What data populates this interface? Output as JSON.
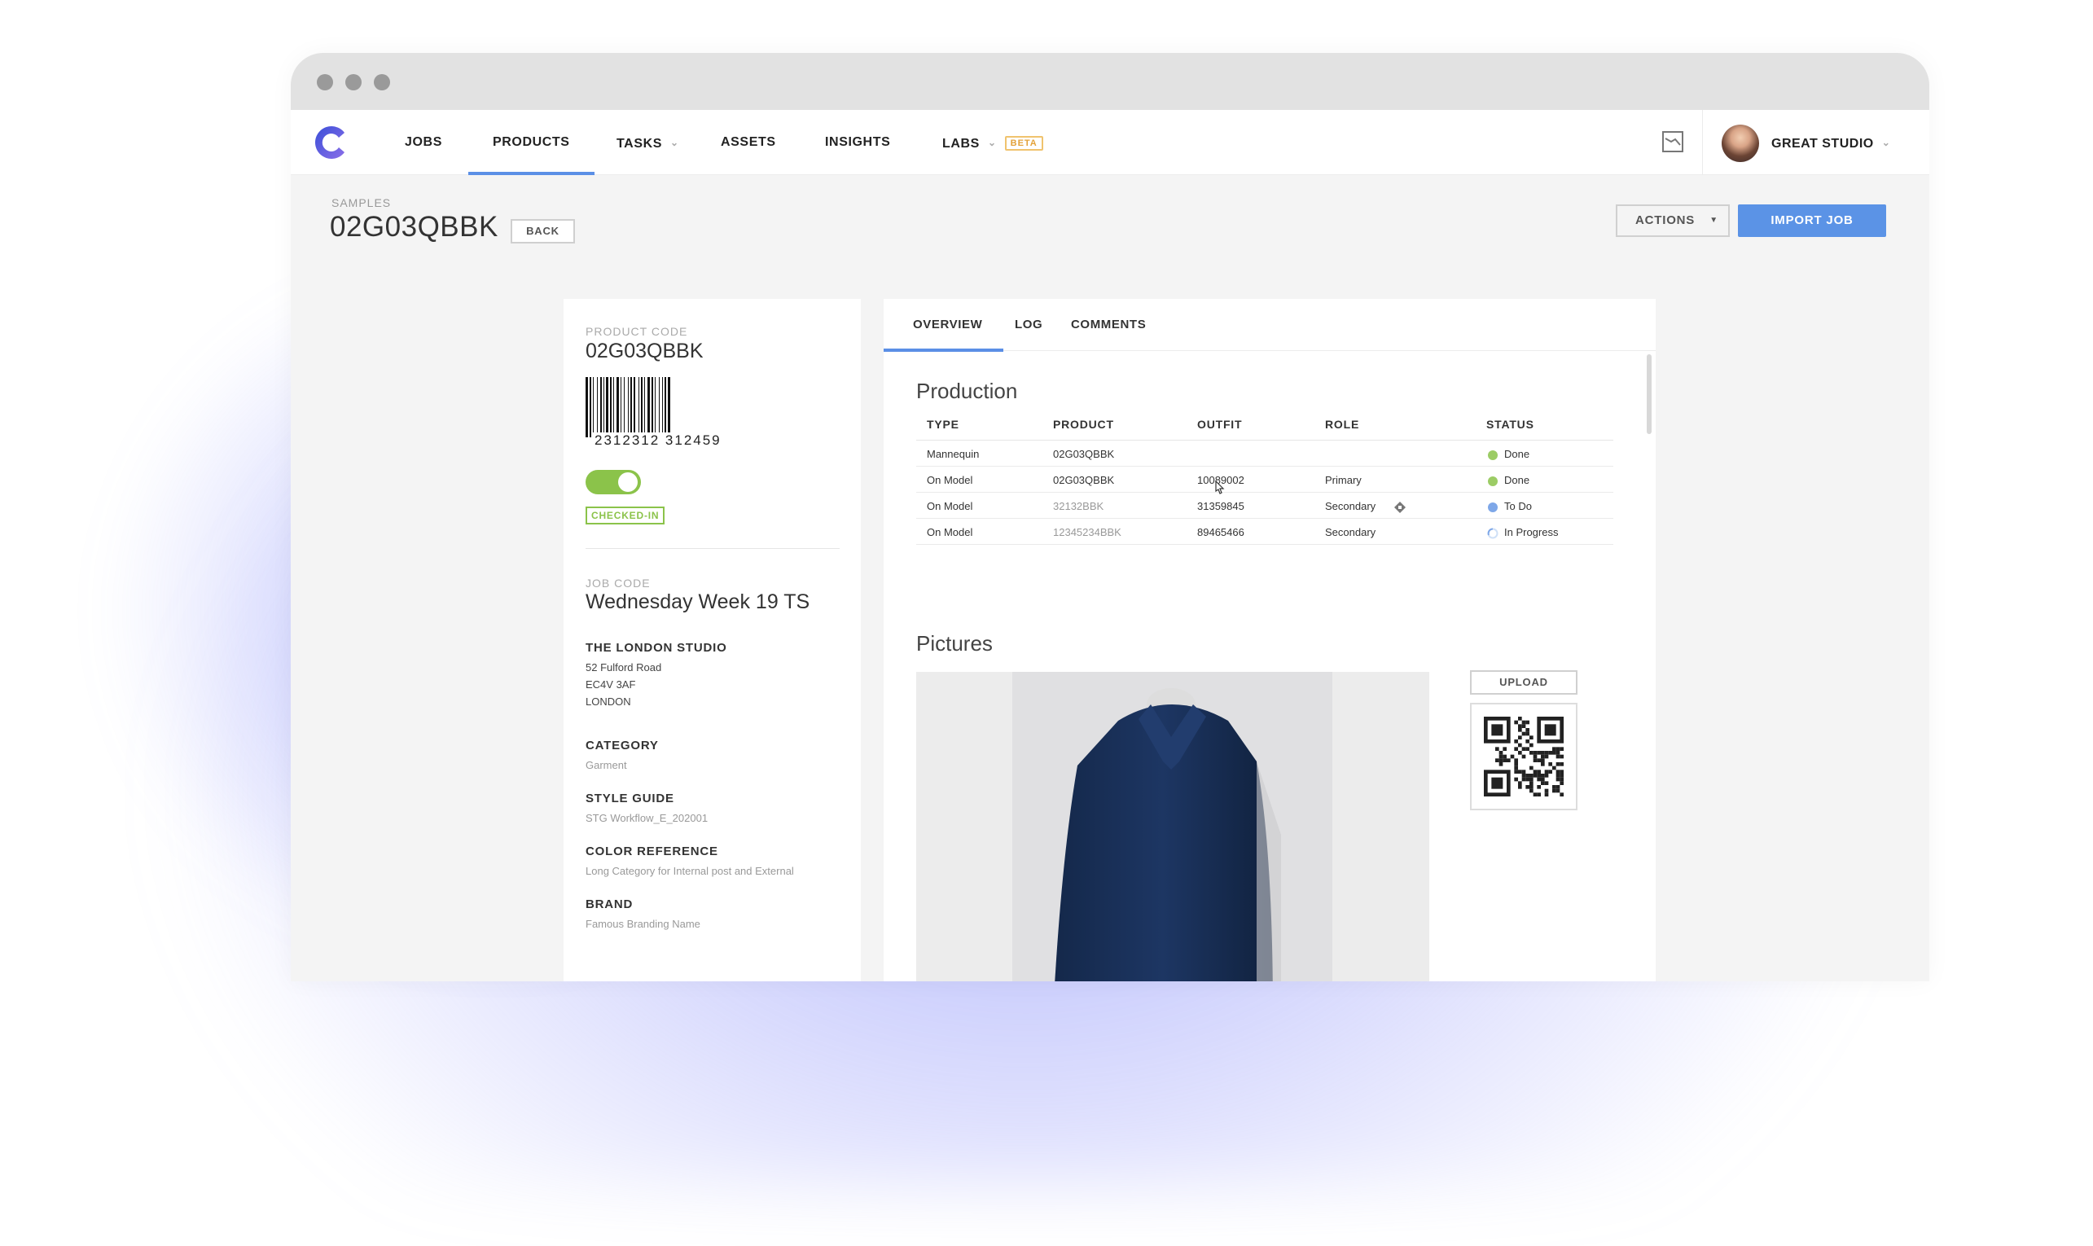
{
  "nav": {
    "items": [
      {
        "label": "JOBS"
      },
      {
        "label": "PRODUCTS"
      },
      {
        "label": "TASKS"
      },
      {
        "label": "ASSETS"
      },
      {
        "label": "INSIGHTS"
      },
      {
        "label": "LABS"
      }
    ],
    "active": "PRODUCTS",
    "beta_badge": "BETA",
    "account_name": "GREAT STUDIO"
  },
  "header": {
    "breadcrumb": "SAMPLES",
    "title": "02G03QBBK",
    "back_label": "BACK",
    "actions_label": "ACTIONS",
    "import_label": "IMPORT JOB"
  },
  "product": {
    "code_label": "PRODUCT CODE",
    "code": "02G03QBBK",
    "barcode_text": "2312312 312459",
    "checked_in_label": "CHECKED-IN",
    "job_code_label": "JOB CODE",
    "job_code": "Wednesday Week 19 TS",
    "studio_name": "THE LONDON STUDIO",
    "address": [
      "52  Fulford Road",
      "EC4V 3AF",
      "LONDON"
    ],
    "category_label": "CATEGORY",
    "category": "Garment",
    "style_guide_label": "STYLE GUIDE",
    "style_guide": "STG Workflow_E_202001",
    "color_ref_label": "COLOR REFERENCE",
    "color_ref": "Long Category for Internal post and External",
    "brand_label": "BRAND",
    "brand": "Famous Branding Name"
  },
  "tabs": [
    {
      "label": "OVERVIEW"
    },
    {
      "label": "LOG"
    },
    {
      "label": "COMMENTS"
    }
  ],
  "production": {
    "title": "Production",
    "columns": [
      "TYPE",
      "PRODUCT",
      "OUTFIT",
      "ROLE",
      "STATUS"
    ],
    "rows": [
      {
        "type": "Mannequin",
        "product": "02G03QBBK",
        "outfit": "",
        "role": "",
        "status": "Done"
      },
      {
        "type": "On Model",
        "product": "02G03QBBK",
        "outfit": "10089002",
        "role": "Primary",
        "status": "Done"
      },
      {
        "type": "On Model",
        "product": "32132BBK",
        "outfit": "31359845",
        "role": "Secondary",
        "status": "To Do"
      },
      {
        "type": "On Model",
        "product": "12345234BBK",
        "outfit": "89465466",
        "role": "Secondary",
        "status": "In Progress"
      }
    ]
  },
  "pictures": {
    "title": "Pictures",
    "upload_label": "UPLOAD"
  },
  "colors": {
    "accent": "#5b8fe6",
    "done": "#9ccc65",
    "todo": "#7ea7e8",
    "checked_in": "#8bc34a",
    "beta": "#e3a23a"
  },
  "icons": [
    "app-logo-icon",
    "chevron-down-icon",
    "chart-icon",
    "caret-down-icon",
    "diamond-icon",
    "cursor-icon",
    "qr-code-icon",
    "barcode-icon"
  ]
}
